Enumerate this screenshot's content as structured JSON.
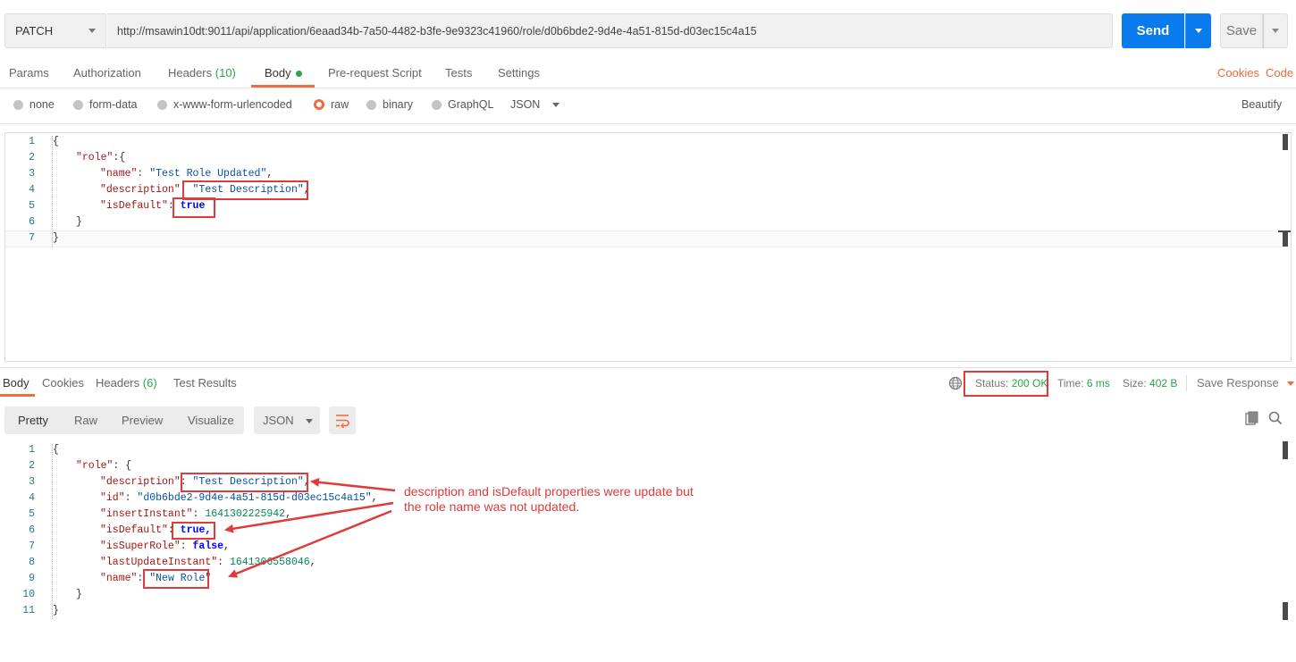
{
  "request": {
    "method": "PATCH",
    "url": "http://msawin10dt:9011/api/application/6eaad34b-7a50-4482-b3fe-9e9323c41960/role/d0b6bde2-9d4e-4a51-815d-d03ec15c4a15",
    "send_label": "Send",
    "save_label": "Save"
  },
  "request_tabs": {
    "params": "Params",
    "authorization": "Authorization",
    "headers": "Headers",
    "headers_count": "(10)",
    "body": "Body",
    "prerequest": "Pre-request Script",
    "tests": "Tests",
    "settings": "Settings",
    "cookies": "Cookies",
    "code": "Code"
  },
  "body_types": {
    "none": "none",
    "form_data": "form-data",
    "urlencoded": "x-www-form-urlencoded",
    "raw": "raw",
    "binary": "binary",
    "graphql": "GraphQL",
    "format": "JSON",
    "beautify": "Beautify"
  },
  "request_body": {
    "line_numbers": [
      "1",
      "2",
      "3",
      "4",
      "5",
      "6",
      "7"
    ],
    "l1": "{",
    "l2_key": "\"role\"",
    "l2_rest": ":{",
    "l3_key": "\"name\"",
    "l3_val": "\"Test Role Updated\"",
    "l4_key": "\"description\"",
    "l4_val": "\"Test Description\"",
    "l5_key": "\"isDefault\"",
    "l5_val": "true",
    "l6": "}",
    "l7": "}"
  },
  "response_tabs": {
    "body": "Body",
    "cookies": "Cookies",
    "headers": "Headers",
    "headers_count": "(6)",
    "test_results": "Test Results"
  },
  "response_meta": {
    "status_label": "Status:",
    "status_value": "200 OK",
    "time_label": "Time:",
    "time_value": "6 ms",
    "size_label": "Size:",
    "size_value": "402 B",
    "save_response": "Save Response"
  },
  "response_views": {
    "pretty": "Pretty",
    "raw": "Raw",
    "preview": "Preview",
    "visualize": "Visualize",
    "format": "JSON"
  },
  "response_body": {
    "line_numbers": [
      "1",
      "2",
      "3",
      "4",
      "5",
      "6",
      "7",
      "8",
      "9",
      "10",
      "11"
    ],
    "l1": "{",
    "l2_key": "\"role\"",
    "l2_rest": ": {",
    "l3_key": "\"description\"",
    "l3_val": "\"Test Description\",",
    "l4_key": "\"id\"",
    "l4_val": "\"d0b6bde2-9d4e-4a51-815d-d03ec15c4a15\"",
    "l5_key": "\"insertInstant\"",
    "l5_val": "1641302225942",
    "l6_key": "\"isDefault\"",
    "l6_val": "true,",
    "l7_key": "\"isSuperRole\"",
    "l7_val": "false",
    "l8_key": "\"lastUpdateInstant\"",
    "l8_val": "1641306558046",
    "l9_key": "\"name\"",
    "l9_val": "\"New Role\"",
    "l10": "}",
    "l11": "}"
  },
  "annotation": {
    "line1": "description and isDefault properties were update but",
    "line2": "the role name was not updated."
  },
  "colors": {
    "accent": "#f26b3a",
    "send": "#097bed",
    "status_ok": "#26a54a",
    "annotation": "#e03a3a"
  }
}
